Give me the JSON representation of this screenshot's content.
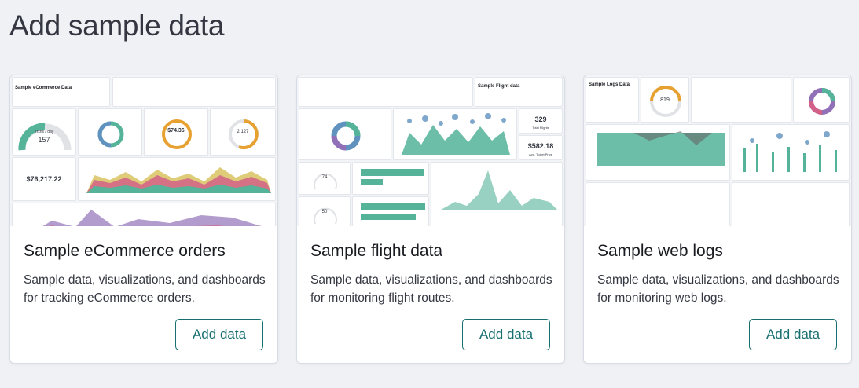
{
  "page": {
    "title": "Add sample data"
  },
  "cards": [
    {
      "title": "Sample eCommerce orders",
      "description": "Sample data, visualizations, and dashboards for tracking eCommerce orders.",
      "button": "Add data",
      "thumb": {
        "heading": "Sample eCommerce Data",
        "gauge_value": "157",
        "gauge_label": "Trxns / day",
        "avg_spend": "$74.36",
        "avg_items": "2.127",
        "total": "$76,217.22"
      }
    },
    {
      "title": "Sample flight data",
      "description": "Sample data, visualizations, and dashboards for monitoring flight routes.",
      "button": "Add data",
      "thumb": {
        "heading": "Sample Flight data",
        "flights": "329",
        "flights_label": "Total Flights",
        "avg_price": "$582.18",
        "avg_price_label": "Avg. Ticket Price",
        "delays": "74",
        "cancellations": "50"
      }
    },
    {
      "title": "Sample web logs",
      "description": "Sample data, visualizations, and dashboards for monitoring web logs.",
      "button": "Add data",
      "thumb": {
        "heading": "Sample Logs Data",
        "gauge_value": "819"
      }
    }
  ],
  "colors": {
    "accent": "#176e70",
    "green": "#54b399",
    "blue": "#6092c0",
    "orange": "#e7a131",
    "pink": "#d36086",
    "purple": "#9170b8"
  }
}
